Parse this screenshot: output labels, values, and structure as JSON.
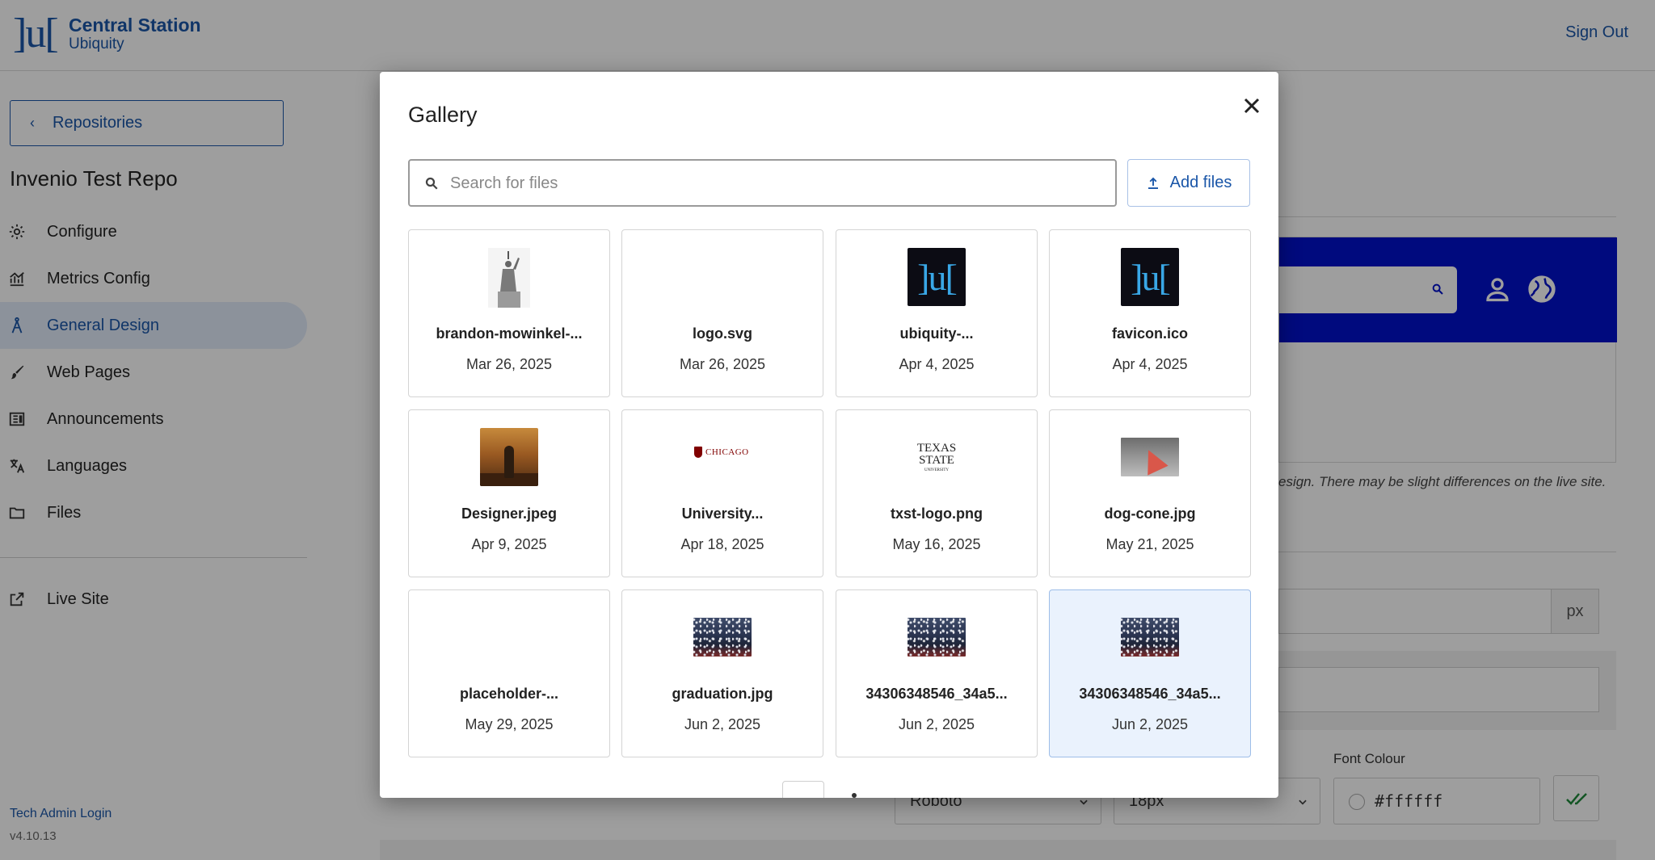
{
  "header": {
    "logo_text": "]u[",
    "brand_title": "Central Station",
    "brand_subtitle": "Ubiquity",
    "sign_out": "Sign Out"
  },
  "sidebar": {
    "back_button": "Repositories",
    "repo_title": "Invenio Test Repo",
    "items": [
      {
        "label": "Configure",
        "icon": "gear-icon"
      },
      {
        "label": "Metrics Config",
        "icon": "chart-icon"
      },
      {
        "label": "General Design",
        "icon": "design-icon",
        "active": true
      },
      {
        "label": "Web Pages",
        "icon": "brush-icon"
      },
      {
        "label": "Announcements",
        "icon": "announcement-icon"
      },
      {
        "label": "Languages",
        "icon": "translate-icon"
      },
      {
        "label": "Files",
        "icon": "folder-icon"
      }
    ],
    "live_site": "Live Site",
    "tech_admin_login": "Tech Admin Login",
    "version": "v4.10.13"
  },
  "main": {
    "preview_note": "esign. There may be slight differences on the live site.",
    "size_unit": "px",
    "font_colour_label": "Font Colour",
    "font_family_value": "Roboto",
    "font_size_value": "18px",
    "font_colour_value": "#ffffff",
    "preview_header_color": "#0011cc"
  },
  "gallery": {
    "title": "Gallery",
    "search_placeholder": "Search for files",
    "search_value": "",
    "add_files": "Add files",
    "files": [
      {
        "name": "brandon-mowinkel-...",
        "date": "Mar 26, 2025",
        "thumb": "statue"
      },
      {
        "name": "logo.svg",
        "date": "Mar 26, 2025",
        "thumb": "none"
      },
      {
        "name": "ubiquity-...",
        "date": "Apr 4, 2025",
        "thumb": "ulogo"
      },
      {
        "name": "favicon.ico",
        "date": "Apr 4, 2025",
        "thumb": "ulogo"
      },
      {
        "name": "Designer.jpeg",
        "date": "Apr 9, 2025",
        "thumb": "designer"
      },
      {
        "name": "University...",
        "date": "Apr 18, 2025",
        "thumb": "chicago"
      },
      {
        "name": "txst-logo.png",
        "date": "May 16, 2025",
        "thumb": "texas"
      },
      {
        "name": "dog-cone.jpg",
        "date": "May 21, 2025",
        "thumb": "dog"
      },
      {
        "name": "placeholder-...",
        "date": "May 29, 2025",
        "thumb": "none"
      },
      {
        "name": "graduation.jpg",
        "date": "Jun 2, 2025",
        "thumb": "crowd"
      },
      {
        "name": "34306348546_34a5...",
        "date": "Jun 2, 2025",
        "thumb": "crowd"
      },
      {
        "name": "34306348546_34a5...",
        "date": "Jun 2, 2025",
        "thumb": "crowd",
        "selected": true
      }
    ],
    "chicago_logo_text": "CHICAGO",
    "texas_logo_text": [
      "TEXAS",
      "STATE",
      "UNIVERSITY"
    ],
    "ulogo_text": "]u["
  }
}
